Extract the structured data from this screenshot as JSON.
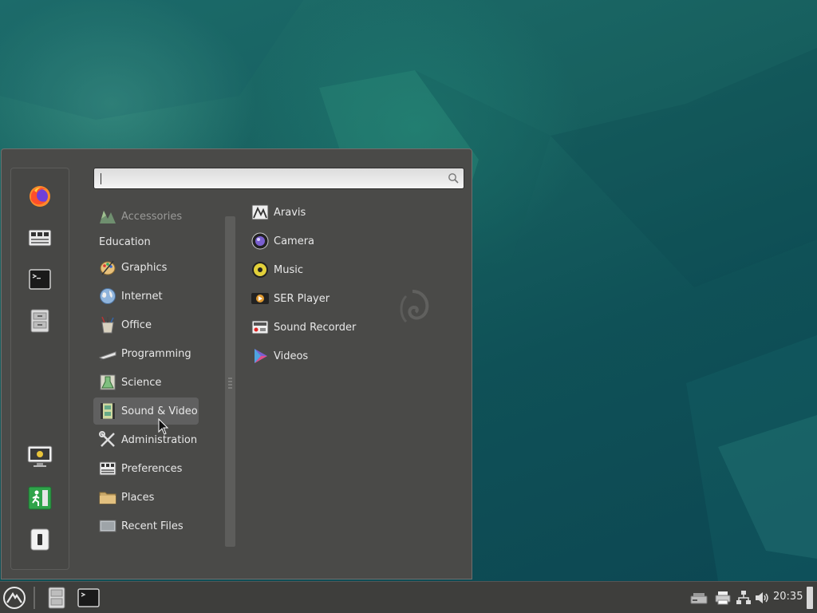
{
  "search": {
    "placeholder": "",
    "value": ""
  },
  "favorites": [
    {
      "name": "firefox-icon"
    },
    {
      "name": "settings-icon"
    },
    {
      "name": "terminal-icon"
    },
    {
      "name": "file-manager-icon"
    },
    {
      "name": "lock-screen-icon"
    },
    {
      "name": "logout-icon"
    },
    {
      "name": "shutdown-icon"
    }
  ],
  "categories": [
    {
      "label": "Accessories",
      "icon": "accessories-icon",
      "dim": true
    },
    {
      "label": "Education"
    },
    {
      "label": "Graphics",
      "icon": "graphics-icon"
    },
    {
      "label": "Internet",
      "icon": "internet-icon"
    },
    {
      "label": "Office",
      "icon": "office-icon"
    },
    {
      "label": "Programming",
      "icon": "programming-icon"
    },
    {
      "label": "Science",
      "icon": "science-icon"
    },
    {
      "label": "Sound & Video",
      "icon": "sound-video-icon",
      "selected": true
    },
    {
      "label": "Administration",
      "icon": "administration-icon"
    },
    {
      "label": "Preferences",
      "icon": "preferences-icon"
    },
    {
      "label": "Places",
      "icon": "folder-icon"
    },
    {
      "label": "Recent Files",
      "icon": "recent-files-icon"
    }
  ],
  "apps": [
    {
      "label": "Aravis",
      "icon": "aravis-icon"
    },
    {
      "label": "Camera",
      "icon": "camera-icon"
    },
    {
      "label": "Music",
      "icon": "music-icon"
    },
    {
      "label": "SER Player",
      "icon": "ser-player-icon"
    },
    {
      "label": "Sound Recorder",
      "icon": "sound-recorder-icon"
    },
    {
      "label": "Videos",
      "icon": "videos-icon"
    }
  ],
  "panel": {
    "clock": "20:35",
    "launchers": [
      "file-manager-icon",
      "terminal-icon"
    ],
    "tray": [
      "removable-drive-icon",
      "printer-icon",
      "network-icon",
      "volume-icon"
    ]
  }
}
